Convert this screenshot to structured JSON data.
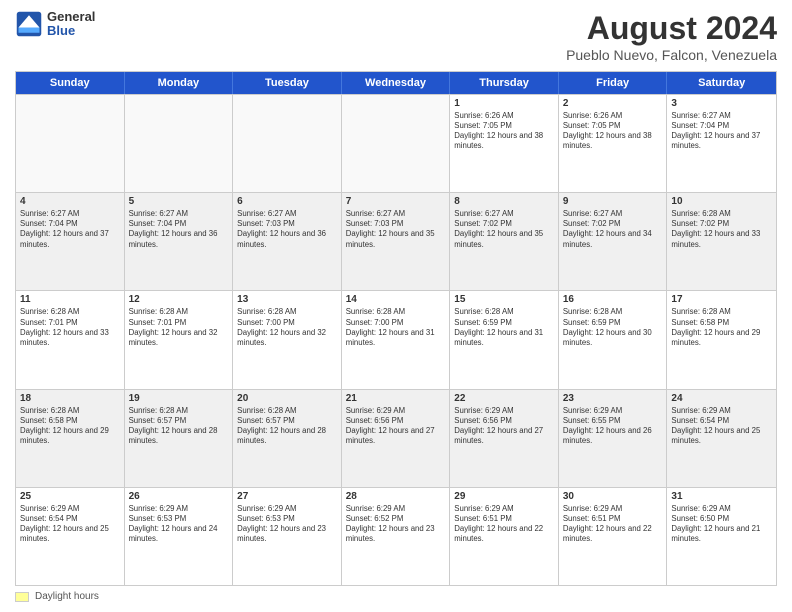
{
  "logo": {
    "general": "General",
    "blue": "Blue"
  },
  "title": "August 2024",
  "subtitle": "Pueblo Nuevo, Falcon, Venezuela",
  "days": [
    "Sunday",
    "Monday",
    "Tuesday",
    "Wednesday",
    "Thursday",
    "Friday",
    "Saturday"
  ],
  "weeks": [
    [
      {
        "day": "",
        "text": ""
      },
      {
        "day": "",
        "text": ""
      },
      {
        "day": "",
        "text": ""
      },
      {
        "day": "",
        "text": ""
      },
      {
        "day": "1",
        "text": "Sunrise: 6:26 AM\nSunset: 7:05 PM\nDaylight: 12 hours and 38 minutes."
      },
      {
        "day": "2",
        "text": "Sunrise: 6:26 AM\nSunset: 7:05 PM\nDaylight: 12 hours and 38 minutes."
      },
      {
        "day": "3",
        "text": "Sunrise: 6:27 AM\nSunset: 7:04 PM\nDaylight: 12 hours and 37 minutes."
      }
    ],
    [
      {
        "day": "4",
        "text": "Sunrise: 6:27 AM\nSunset: 7:04 PM\nDaylight: 12 hours and 37 minutes."
      },
      {
        "day": "5",
        "text": "Sunrise: 6:27 AM\nSunset: 7:04 PM\nDaylight: 12 hours and 36 minutes."
      },
      {
        "day": "6",
        "text": "Sunrise: 6:27 AM\nSunset: 7:03 PM\nDaylight: 12 hours and 36 minutes."
      },
      {
        "day": "7",
        "text": "Sunrise: 6:27 AM\nSunset: 7:03 PM\nDaylight: 12 hours and 35 minutes."
      },
      {
        "day": "8",
        "text": "Sunrise: 6:27 AM\nSunset: 7:02 PM\nDaylight: 12 hours and 35 minutes."
      },
      {
        "day": "9",
        "text": "Sunrise: 6:27 AM\nSunset: 7:02 PM\nDaylight: 12 hours and 34 minutes."
      },
      {
        "day": "10",
        "text": "Sunrise: 6:28 AM\nSunset: 7:02 PM\nDaylight: 12 hours and 33 minutes."
      }
    ],
    [
      {
        "day": "11",
        "text": "Sunrise: 6:28 AM\nSunset: 7:01 PM\nDaylight: 12 hours and 33 minutes."
      },
      {
        "day": "12",
        "text": "Sunrise: 6:28 AM\nSunset: 7:01 PM\nDaylight: 12 hours and 32 minutes."
      },
      {
        "day": "13",
        "text": "Sunrise: 6:28 AM\nSunset: 7:00 PM\nDaylight: 12 hours and 32 minutes."
      },
      {
        "day": "14",
        "text": "Sunrise: 6:28 AM\nSunset: 7:00 PM\nDaylight: 12 hours and 31 minutes."
      },
      {
        "day": "15",
        "text": "Sunrise: 6:28 AM\nSunset: 6:59 PM\nDaylight: 12 hours and 31 minutes."
      },
      {
        "day": "16",
        "text": "Sunrise: 6:28 AM\nSunset: 6:59 PM\nDaylight: 12 hours and 30 minutes."
      },
      {
        "day": "17",
        "text": "Sunrise: 6:28 AM\nSunset: 6:58 PM\nDaylight: 12 hours and 29 minutes."
      }
    ],
    [
      {
        "day": "18",
        "text": "Sunrise: 6:28 AM\nSunset: 6:58 PM\nDaylight: 12 hours and 29 minutes."
      },
      {
        "day": "19",
        "text": "Sunrise: 6:28 AM\nSunset: 6:57 PM\nDaylight: 12 hours and 28 minutes."
      },
      {
        "day": "20",
        "text": "Sunrise: 6:28 AM\nSunset: 6:57 PM\nDaylight: 12 hours and 28 minutes."
      },
      {
        "day": "21",
        "text": "Sunrise: 6:29 AM\nSunset: 6:56 PM\nDaylight: 12 hours and 27 minutes."
      },
      {
        "day": "22",
        "text": "Sunrise: 6:29 AM\nSunset: 6:56 PM\nDaylight: 12 hours and 27 minutes."
      },
      {
        "day": "23",
        "text": "Sunrise: 6:29 AM\nSunset: 6:55 PM\nDaylight: 12 hours and 26 minutes."
      },
      {
        "day": "24",
        "text": "Sunrise: 6:29 AM\nSunset: 6:54 PM\nDaylight: 12 hours and 25 minutes."
      }
    ],
    [
      {
        "day": "25",
        "text": "Sunrise: 6:29 AM\nSunset: 6:54 PM\nDaylight: 12 hours and 25 minutes."
      },
      {
        "day": "26",
        "text": "Sunrise: 6:29 AM\nSunset: 6:53 PM\nDaylight: 12 hours and 24 minutes."
      },
      {
        "day": "27",
        "text": "Sunrise: 6:29 AM\nSunset: 6:53 PM\nDaylight: 12 hours and 23 minutes."
      },
      {
        "day": "28",
        "text": "Sunrise: 6:29 AM\nSunset: 6:52 PM\nDaylight: 12 hours and 23 minutes."
      },
      {
        "day": "29",
        "text": "Sunrise: 6:29 AM\nSunset: 6:51 PM\nDaylight: 12 hours and 22 minutes."
      },
      {
        "day": "30",
        "text": "Sunrise: 6:29 AM\nSunset: 6:51 PM\nDaylight: 12 hours and 22 minutes."
      },
      {
        "day": "31",
        "text": "Sunrise: 6:29 AM\nSunset: 6:50 PM\nDaylight: 12 hours and 21 minutes."
      }
    ]
  ],
  "footer": {
    "swatch_label": "Daylight hours"
  }
}
